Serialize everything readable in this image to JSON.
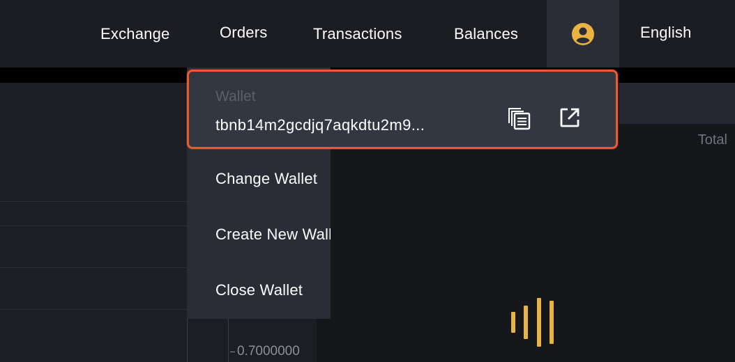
{
  "nav": {
    "exchange": "Exchange",
    "orders": "Orders",
    "transactions": "Transactions",
    "balances": "Balances",
    "language": "English"
  },
  "wallet_menu": {
    "wallet_label": "Wallet",
    "address": "tbnb14m2gcdjq7aqkdtu2m9...",
    "items": [
      {
        "label": "Change Wallet"
      },
      {
        "label": "Create New Wallet"
      },
      {
        "label": "Close Wallet"
      }
    ]
  },
  "background": {
    "total_label": "Total",
    "price_label": "0.7000000"
  },
  "colors": {
    "accent": "#ec5a31",
    "account_icon": "#e8b340",
    "loader": "#e8b340"
  },
  "icons": {
    "account": "user-circle-icon",
    "copy": "copy-icon",
    "open": "external-link-icon",
    "loader": "loading-bars-icon"
  }
}
